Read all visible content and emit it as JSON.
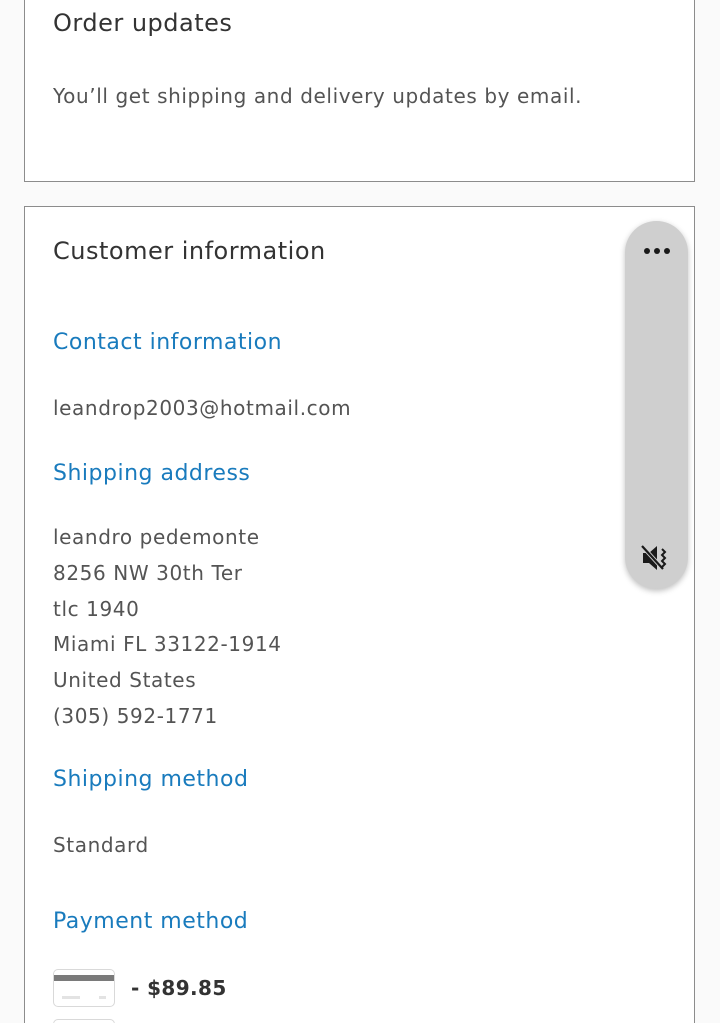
{
  "order_updates": {
    "title": "Order updates",
    "text": "You’ll get shipping and delivery updates by email."
  },
  "customer_info": {
    "title": "Customer information",
    "contact": {
      "heading": "Contact information",
      "email": "leandrop2003@hotmail.com"
    },
    "shipping_address": {
      "heading": "Shipping address",
      "lines": [
        "leandro pedemonte",
        "8256 NW 30th Ter",
        "tlc 1940",
        "Miami FL 33122-1914",
        "United States",
        "(305) 592-1771"
      ]
    },
    "shipping_method": {
      "heading": "Shipping method",
      "value": "Standard"
    },
    "payment_method": {
      "heading": "Payment method",
      "amount": "- $89.85"
    }
  },
  "floating_panel": {
    "icons": [
      "more-icon",
      "mute-icon"
    ]
  },
  "colors": {
    "accent": "#197bbd",
    "text": "#333333",
    "muted_text": "#545454",
    "panel": "#cfcfcf"
  }
}
